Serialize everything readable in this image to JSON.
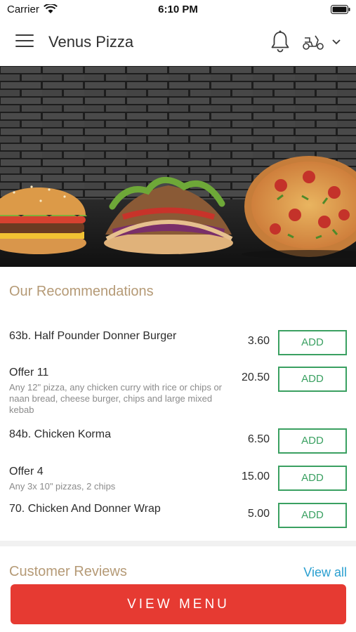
{
  "status_bar": {
    "carrier": "Carrier",
    "time": "6:10 PM"
  },
  "header": {
    "title": "Venus Pizza",
    "icons": [
      "menu-icon",
      "bell-icon",
      "scooter-icon",
      "chevron-down-icon"
    ]
  },
  "recommendations": {
    "title": "Our Recommendations",
    "add_label": "ADD",
    "items": [
      {
        "name": "63b. Half Pounder Donner Burger",
        "desc": "",
        "price": "3.60"
      },
      {
        "name": "Offer 11",
        "desc": "Any 12\" pizza, any chicken curry with rice or chips or naan bread, cheese burger, chips and large mixed kebab",
        "price": "20.50"
      },
      {
        "name": "84b. Chicken Korma",
        "desc": "",
        "price": "6.50"
      },
      {
        "name": "Offer 4",
        "desc": "Any 3x 10\" pizzas, 2 chips",
        "price": "15.00"
      },
      {
        "name": "70. Chicken And Donner Wrap",
        "desc": "",
        "price": "5.00"
      }
    ]
  },
  "reviews": {
    "title": "Customer Reviews",
    "view_all": "View all"
  },
  "footer": {
    "view_menu": "VIEW MENU"
  },
  "colors": {
    "accent_green": "#3aa061",
    "brand_red": "#e63a32",
    "section_gold": "#b59a76",
    "link_blue": "#2a9fd0"
  }
}
